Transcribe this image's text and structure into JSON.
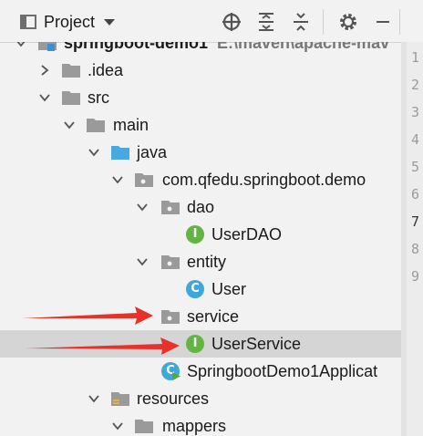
{
  "toolbar": {
    "title": "Project",
    "buttons": [
      "locate-icon",
      "expand-all-icon",
      "collapse-all-icon",
      "settings-icon"
    ]
  },
  "tree": [
    {
      "label": "springboot-demo1",
      "path": "E:\\maven\\apache-mav",
      "bold": true,
      "icon": "module-folder-icon",
      "expanded": true
    },
    {
      "label": ".idea",
      "icon": "folder-icon",
      "expanded": false
    },
    {
      "label": "src",
      "icon": "folder-icon",
      "expanded": true
    },
    {
      "label": "main",
      "icon": "folder-icon",
      "expanded": true
    },
    {
      "label": "java",
      "icon": "source-folder-icon",
      "expanded": true
    },
    {
      "label": "com.qfedu.springboot.demo",
      "icon": "package-icon",
      "expanded": true
    },
    {
      "label": "dao",
      "icon": "package-icon",
      "expanded": true
    },
    {
      "label": "UserDAO",
      "icon": "interface-icon",
      "letter": "I"
    },
    {
      "label": "entity",
      "icon": "package-icon",
      "expanded": true
    },
    {
      "label": "User",
      "icon": "class-icon",
      "letter": "C"
    },
    {
      "label": "service",
      "icon": "package-icon",
      "expanded": false
    },
    {
      "label": "UserService",
      "icon": "interface-icon",
      "letter": "I",
      "selected": true
    },
    {
      "label": "SpringbootDemo1Applicat",
      "icon": "spring-boot-class-icon",
      "letter": "C"
    },
    {
      "label": "resources",
      "icon": "resources-folder-icon",
      "expanded": true
    },
    {
      "label": "mappers",
      "icon": "folder-icon",
      "expanded": false
    }
  ],
  "gutter": {
    "line_numbers": [
      "1",
      "2",
      "3",
      "4",
      "5",
      "6",
      "7",
      "8",
      "9"
    ],
    "current_line": "7"
  },
  "colors": {
    "interface": "#62b543",
    "class": "#40a8d8",
    "annotation_arrow": "#e8312a",
    "selection": "#d5d5d5"
  }
}
